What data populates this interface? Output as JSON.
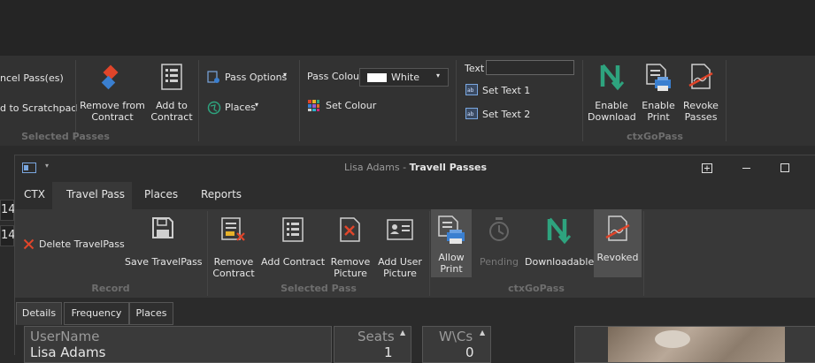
{
  "outer": {
    "cancel_pass": "ncel Pass(es)",
    "add_scratchpad": "d to Scratchpad",
    "remove_from_contract": [
      "Remove from",
      "Contract"
    ],
    "add_to_contract": [
      "Add to",
      "Contract"
    ],
    "group_selected_passes": "Selected Passes",
    "pass_options": "Pass Options",
    "places": "Places",
    "pass_colour_label": "Pass Colour",
    "pass_colour_value": "White",
    "set_colour": "Set Colour",
    "text_label": "Text",
    "set_text_1": "Set Text 1",
    "set_text_2": "Set Text 2",
    "enable_download": [
      "Enable",
      "Download"
    ],
    "enable_print": [
      "Enable",
      "Print"
    ],
    "revoke_passes": [
      "Revoke",
      "Passes"
    ],
    "group_ctxgopass": "ctxGoPass",
    "stub_rows": [
      "14",
      "14"
    ]
  },
  "window": {
    "title_user": "Lisa Adams",
    "title_sep": " - ",
    "title_app": "Travell Passes",
    "tabs": [
      "CTX",
      "Travel Pass",
      "Places",
      "Reports"
    ],
    "delete_travelpass": "Delete TravelPass",
    "save_travelpass": "Save TravelPass",
    "group_record": "Record",
    "remove_contract": [
      "Remove",
      "Contract"
    ],
    "add_contract": "Add Contract",
    "remove_picture": [
      "Remove",
      "Picture"
    ],
    "add_user_picture": [
      "Add User",
      "Picture"
    ],
    "group_selected_pass": "Selected Pass",
    "allow_print": [
      "Allow",
      "Print"
    ],
    "pending": "Pending",
    "downloadable": "Downloadable",
    "revoked": "Revoked",
    "group_ctxgopass": "ctxGoPass",
    "subtabs": [
      "Details",
      "Frequency",
      "Places"
    ],
    "username_placeholder": "UserName",
    "username_value": "Lisa Adams",
    "seats_label": "Seats",
    "seats_value": "1",
    "wcs_label": "W\\Cs",
    "wcs_value": "0"
  },
  "colors": {
    "accent_green": "#2ea37e",
    "accent_red": "#e0452a",
    "accent_blue": "#3a7fd0"
  }
}
